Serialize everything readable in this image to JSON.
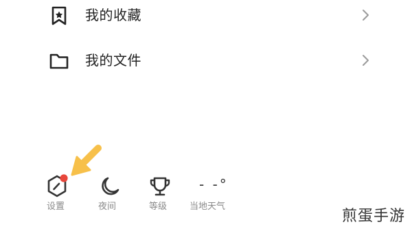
{
  "menu": {
    "favorites_label": "我的收藏",
    "files_label": "我的文件"
  },
  "bottom_bar": {
    "settings_label": "设置",
    "night_label": "夜间",
    "level_label": "等级",
    "weather_label": "当地天气",
    "weather_value": "- -°"
  },
  "watermark": "煎蛋手游",
  "colors": {
    "notification_dot": "#e8473b",
    "annotation_arrow": "#f7c04a",
    "label_gray": "#8a8a8a"
  },
  "icons": {
    "favorites": "bookmark-star-icon",
    "files": "folder-icon",
    "settings": "hexagon-settings-icon",
    "night": "moon-icon",
    "level": "trophy-icon",
    "chevron": "chevron-right-icon"
  }
}
